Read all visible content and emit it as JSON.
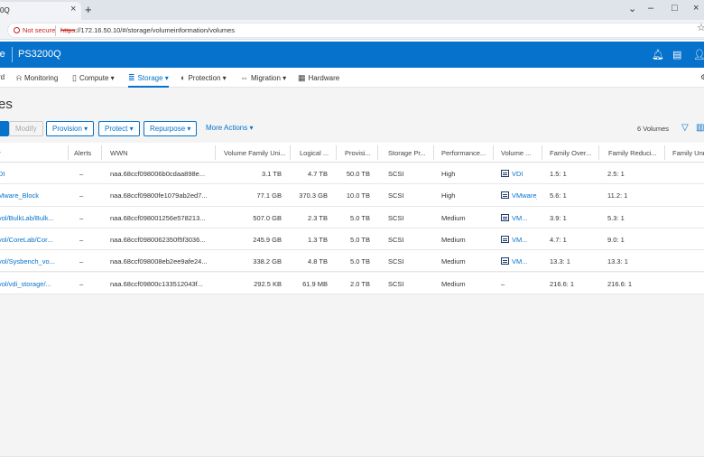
{
  "browser": {
    "tab_title": "0Q",
    "not_secure": "Not secure",
    "url_scheme": "https",
    "url_rest": "://172.16.50.10/#/storage/volumeinformation/volumes"
  },
  "app": {
    "brand": "re",
    "system_name": "PS3200Q"
  },
  "nav": [
    {
      "label": "rd"
    },
    {
      "label": "Monitoring"
    },
    {
      "label": "Compute ▾"
    },
    {
      "label": "Storage ▾"
    },
    {
      "label": "Protection ▾"
    },
    {
      "label": "Migration ▾"
    },
    {
      "label": "Hardware"
    }
  ],
  "page_title": "es",
  "toolbar": {
    "modify": "Modify",
    "provision": "Provision ▾",
    "protect": "Protect ▾",
    "repurpose": "Repurpose ▾",
    "more_actions": "More Actions ▾",
    "count": "6 Volumes"
  },
  "table": {
    "headers": [
      "↑",
      "Alerts",
      "WWN",
      "Volume Family Uni...",
      "Logical ...",
      "Provisi...",
      "Storage Pr...",
      "Performance...",
      "Volume ...",
      "Family Over...",
      "Family Reduci...",
      "Family Unre"
    ],
    "rows": [
      {
        "name": "DI",
        "alerts": "–",
        "wwn": "naa.68ccf098006b0cdaa898e...",
        "vfu": "3.1 TB",
        "logical": "4.7 TB",
        "prov": "50.0 TB",
        "proto": "SCSI",
        "perf": "High",
        "vg": "VDI",
        "vg_icon": true,
        "fo": "1.5: 1",
        "fr": "2.5: 1"
      },
      {
        "name": "Mware_Block",
        "alerts": "–",
        "wwn": "naa.68ccf09800fe1079ab2ed7...",
        "vfu": "77.1 GB",
        "logical": "370.3 GB",
        "prov": "10.0 TB",
        "proto": "SCSI",
        "perf": "High",
        "vg": "VMware_Block",
        "vg_icon": true,
        "fo": "5.6: 1",
        "fr": "11.2: 1"
      },
      {
        "name": "vol/BulkLab/Bulk...",
        "alerts": "–",
        "wwn": "naa.68ccf098001256e578213...",
        "vfu": "507.0 GB",
        "logical": "2.3 TB",
        "prov": "5.0 TB",
        "proto": "SCSI",
        "perf": "Medium",
        "vg": "VM...",
        "vg_icon": true,
        "fo": "3.9: 1",
        "fr": "5.3: 1"
      },
      {
        "name": "vol/CoreLab/Cor...",
        "alerts": "–",
        "wwn": "naa.68ccf0980062350f5f3036...",
        "vfu": "245.9 GB",
        "logical": "1.3 TB",
        "prov": "5.0 TB",
        "proto": "SCSI",
        "perf": "Medium",
        "vg": "VM...",
        "vg_icon": true,
        "fo": "4.7: 1",
        "fr": "9.0: 1"
      },
      {
        "name": "vol/Sysbench_vo...",
        "alerts": "–",
        "wwn": "naa.68ccf098008eb2ee9afe24...",
        "vfu": "338.2 GB",
        "logical": "4.8 TB",
        "prov": "5.0 TB",
        "proto": "SCSI",
        "perf": "Medium",
        "vg": "VM...",
        "vg_icon": true,
        "fo": "13.3: 1",
        "fr": "13.3: 1"
      },
      {
        "name": "vol/vdi_storage/...",
        "alerts": "–",
        "wwn": "naa.68ccf09800c133512043f...",
        "vfu": "292.5 KB",
        "logical": "61.9 MB",
        "prov": "2.0 TB",
        "proto": "SCSI",
        "perf": "Medium",
        "vg": "–",
        "vg_icon": false,
        "fo": "216.6: 1",
        "fr": "216.6: 1"
      }
    ]
  }
}
